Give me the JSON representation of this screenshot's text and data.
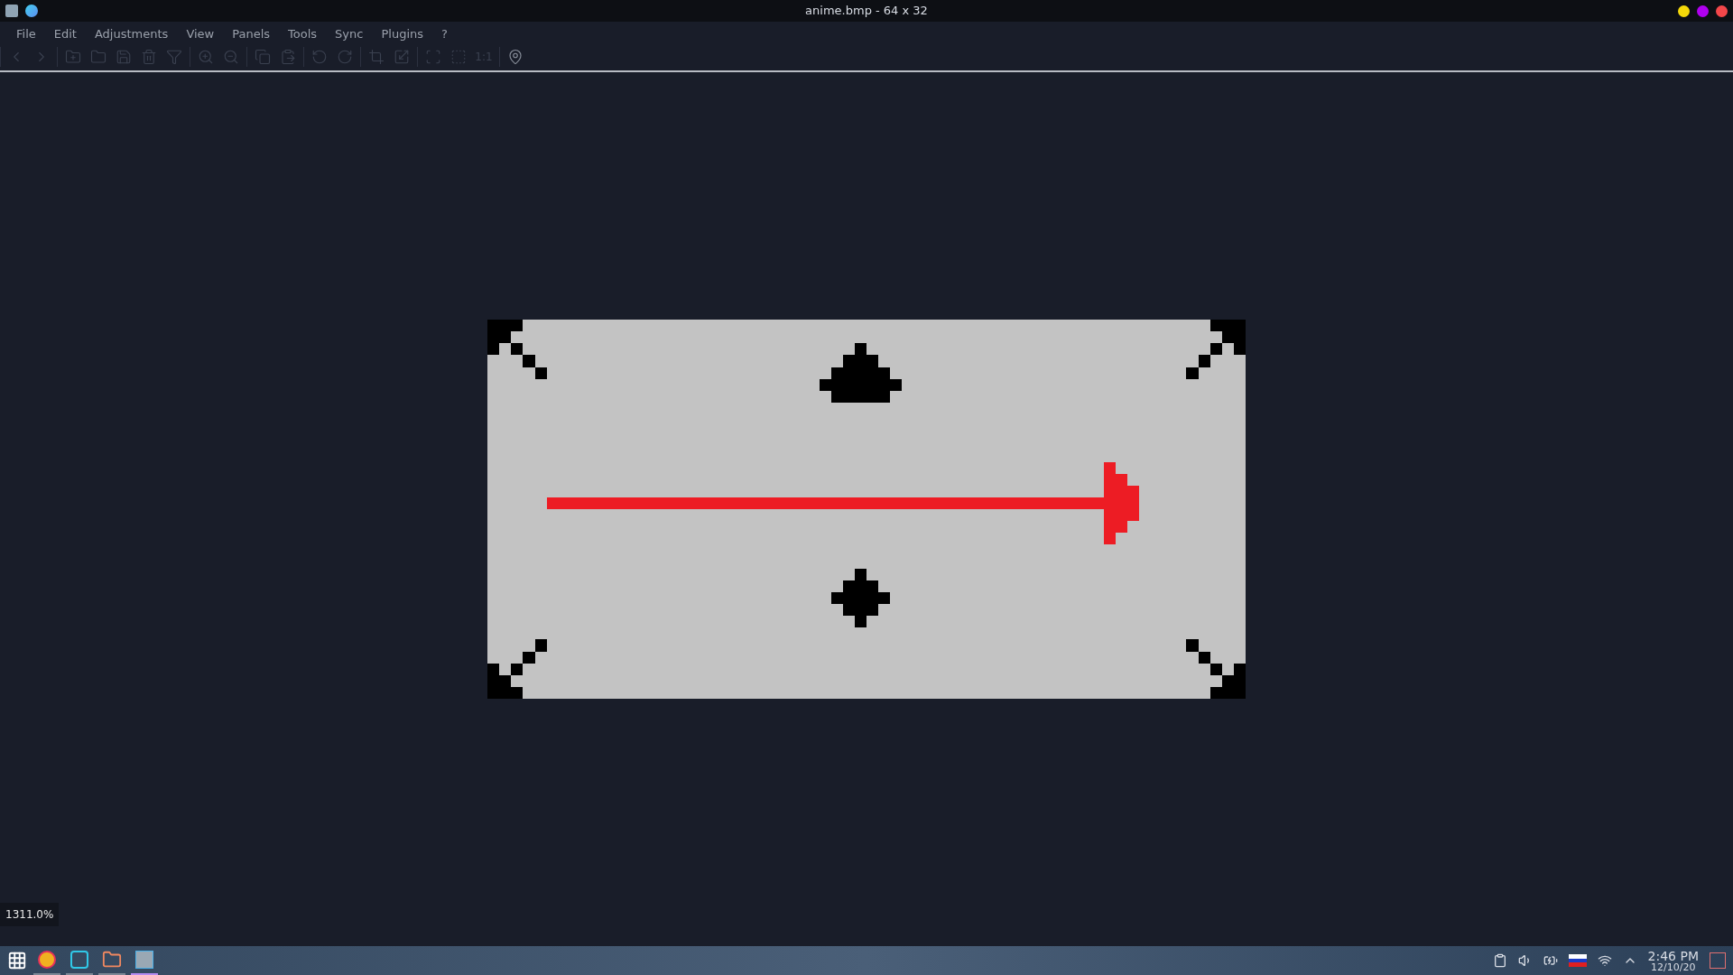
{
  "window": {
    "title": "anime.bmp - 64 x 32",
    "controls": [
      {
        "color": "#f5d90a"
      },
      {
        "color": "#b000f0"
      },
      {
        "color": "#f4474a"
      }
    ]
  },
  "menu": [
    "File",
    "Edit",
    "Adjustments",
    "View",
    "Panels",
    "Tools",
    "Sync",
    "Plugins",
    "?"
  ],
  "toolbar": [
    {
      "buttons": [
        {
          "disabled": true
        },
        {
          "disabled": true
        }
      ]
    },
    {
      "buttons": [
        {
          "disabled": true
        },
        {
          "disabled": true
        },
        {
          "disabled": true
        },
        {
          "disabled": true
        },
        {
          "disabled": true
        }
      ]
    },
    {
      "buttons": [
        {
          "disabled": true
        },
        {
          "disabled": true
        }
      ]
    },
    {
      "buttons": [
        {
          "disabled": true
        },
        {
          "disabled": true
        }
      ]
    },
    {
      "buttons": [
        {
          "disabled": true
        },
        {
          "disabled": true
        }
      ]
    },
    {
      "buttons": [
        {
          "disabled": true
        },
        {
          "disabled": true
        }
      ]
    },
    {
      "buttons": [
        {
          "disabled": true
        },
        {
          "disabled": true
        },
        {
          "label": "1:1",
          "disabled": true
        }
      ]
    },
    {
      "buttons": [
        {
          "disabled": false
        }
      ]
    }
  ],
  "zoom_level": "1311.0%",
  "taskbar": {
    "apps": [
      {
        "selected": false
      },
      {
        "selected": false
      },
      {
        "selected": false
      },
      {
        "selected": true
      }
    ],
    "time": "2:46 PM",
    "date": "12/10/20"
  }
}
